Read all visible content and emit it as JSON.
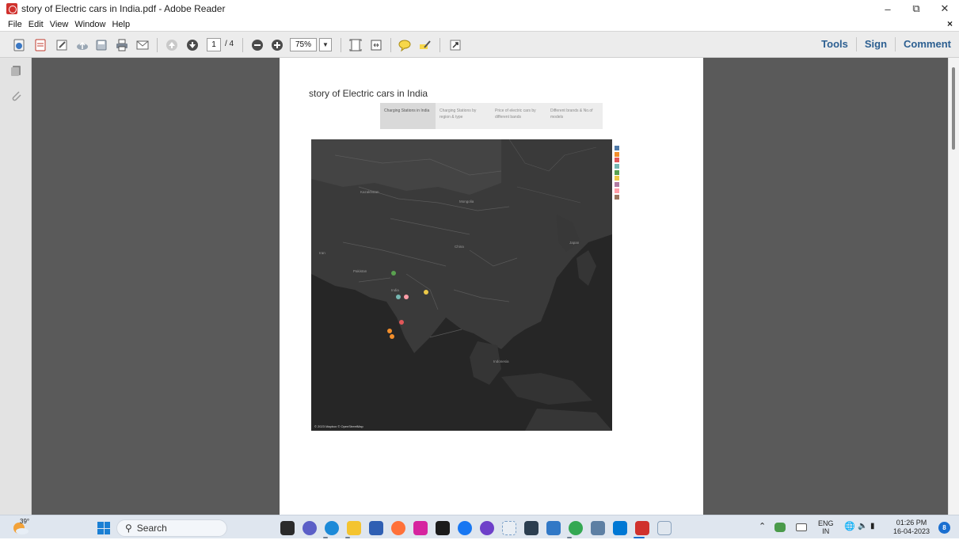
{
  "window": {
    "title": "story of Electric cars in India.pdf - Adobe Reader"
  },
  "menu": [
    "File",
    "Edit",
    "View",
    "Window",
    "Help"
  ],
  "toolbar": {
    "page_current": "1",
    "page_total": "/ 4",
    "zoom": "75%",
    "tools_label": "Tools",
    "sign_label": "Sign",
    "comment_label": "Comment"
  },
  "document": {
    "title": "story of Electric cars in India",
    "tabs": [
      {
        "label": "Charging Stations in India",
        "active": true
      },
      {
        "label": "Charging Stations by region & type",
        "active": false
      },
      {
        "label": "Price of electric cars by different bands",
        "active": false
      },
      {
        "label": "Different brands & No.of models",
        "active": false
      }
    ],
    "map": {
      "labels": {
        "kazakhstan": "Kazakhstan",
        "mongolia": "Mongolia",
        "china": "China",
        "iran": "Iran",
        "pakistan": "Pakistan",
        "india": "India",
        "japan": "Japan",
        "indonesia": "Indonesia"
      },
      "attribution": "© 2023 Mapbox © OpenStreetMap",
      "legend_colors": [
        "#4e79a7",
        "#f28e2b",
        "#e15759",
        "#76b7b2",
        "#59a14f",
        "#edc948",
        "#b07aa1",
        "#ff9da7",
        "#9c755f"
      ],
      "points": [
        {
          "color": "#59a14f"
        },
        {
          "color": "#76b7b2"
        },
        {
          "color": "#ff9da7"
        },
        {
          "color": "#edc948"
        },
        {
          "color": "#e15759"
        },
        {
          "color": "#f28e2b"
        },
        {
          "color": "#f28e2b"
        }
      ]
    }
  },
  "taskbar": {
    "weather_temp": "39°",
    "search_placeholder": "Search",
    "lang_top": "ENG",
    "lang_bottom": "IN",
    "time": "01:26 PM",
    "date": "16-04-2023",
    "notification_count": "8"
  }
}
